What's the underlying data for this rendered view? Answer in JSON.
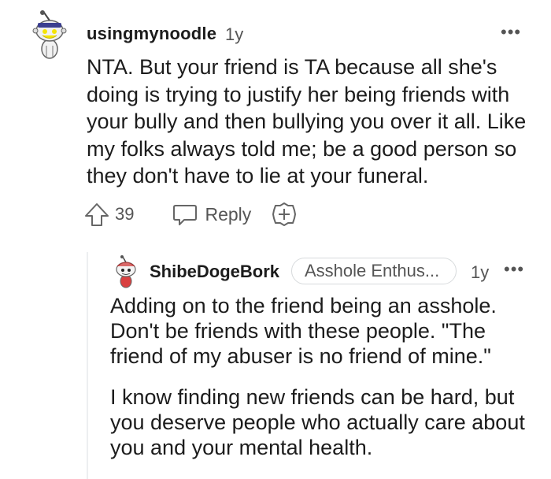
{
  "comment": {
    "username": "usingmynoodle",
    "age": "1y",
    "more": "•••",
    "body": "NTA. But your friend is TA because all she's doing is trying to justify her being friends with your bully and then bullying you over it all. Like my folks always told me; be a good person so they don't have to lie at your funeral.",
    "actions": {
      "vote_count": "39",
      "reply_label": "Reply"
    }
  },
  "reply": {
    "username": "ShibeDogeBork",
    "flair": "Asshole Enthus...",
    "age": "1y",
    "more": "•••",
    "paragraphs": [
      "Adding on to the friend being an asshole. Don't be friends with these people. \"The friend of my abuser is no friend of mine.\"",
      "I know finding new friends can be hard, but you deserve people who actually care about you and your mental health."
    ]
  },
  "colors": {
    "text": "#1c1c1c",
    "meta": "#555555",
    "thread_line": "#edeff1",
    "flair_border": "#d7dadc"
  },
  "icons": {
    "upvote": "upvote-arrow-icon",
    "reply": "speech-bubble-icon",
    "award": "plus-circle-icon",
    "more": "ellipsis-icon"
  }
}
